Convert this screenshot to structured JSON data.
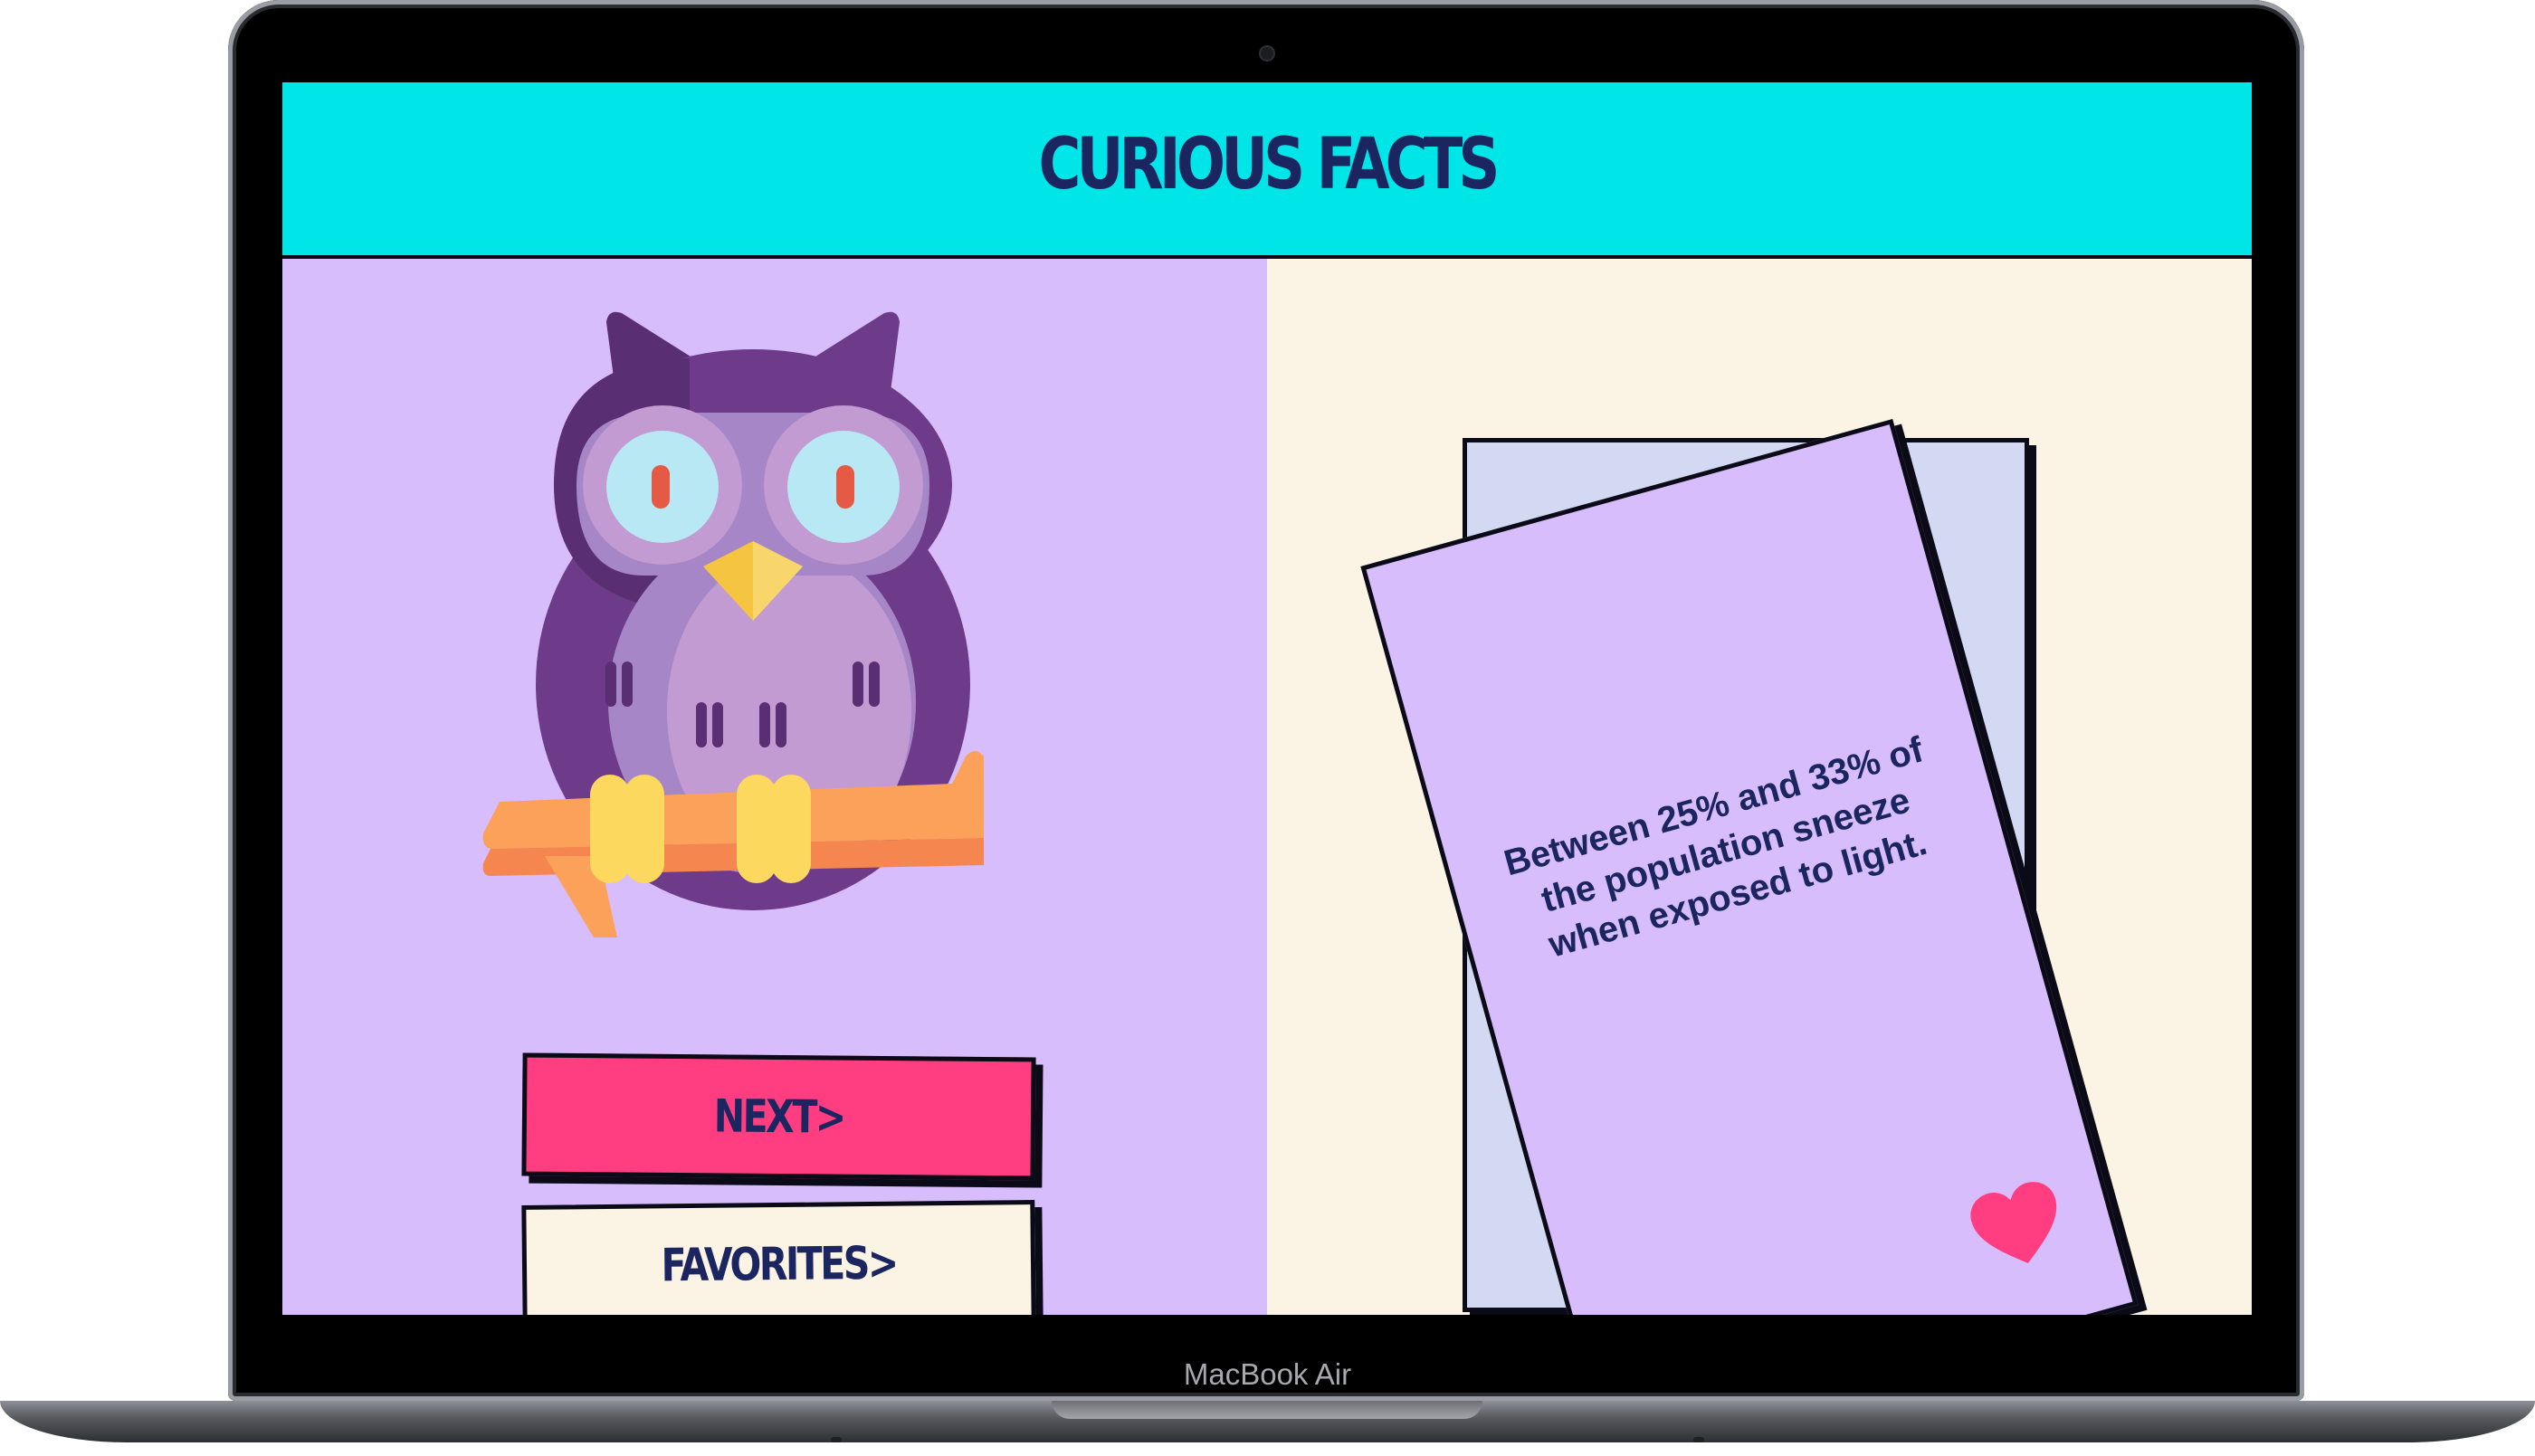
{
  "app": {
    "title": "CURIOUS FACTS"
  },
  "buttons": {
    "next_label": "NEXT>",
    "favorites_label": "FAVORITES>"
  },
  "card": {
    "fact_text": "Between 25% and 33% of the population sneeze when exposed to light.",
    "favorite_icon": "heart-icon"
  },
  "device": {
    "label": "MacBook Air"
  },
  "colors": {
    "header_bg": "#00e5e8",
    "left_panel_bg": "#d8bdfc",
    "right_panel_bg": "#fbf4e4",
    "next_button": "#ff3d80",
    "favorites_button": "#fbf4e4",
    "back_card": "#d3d8f3",
    "front_card": "#d8bdfc",
    "text_navy": "#1b2560",
    "heart": "#ff3d80"
  },
  "illustration": {
    "icon": "owl-on-branch-icon"
  }
}
